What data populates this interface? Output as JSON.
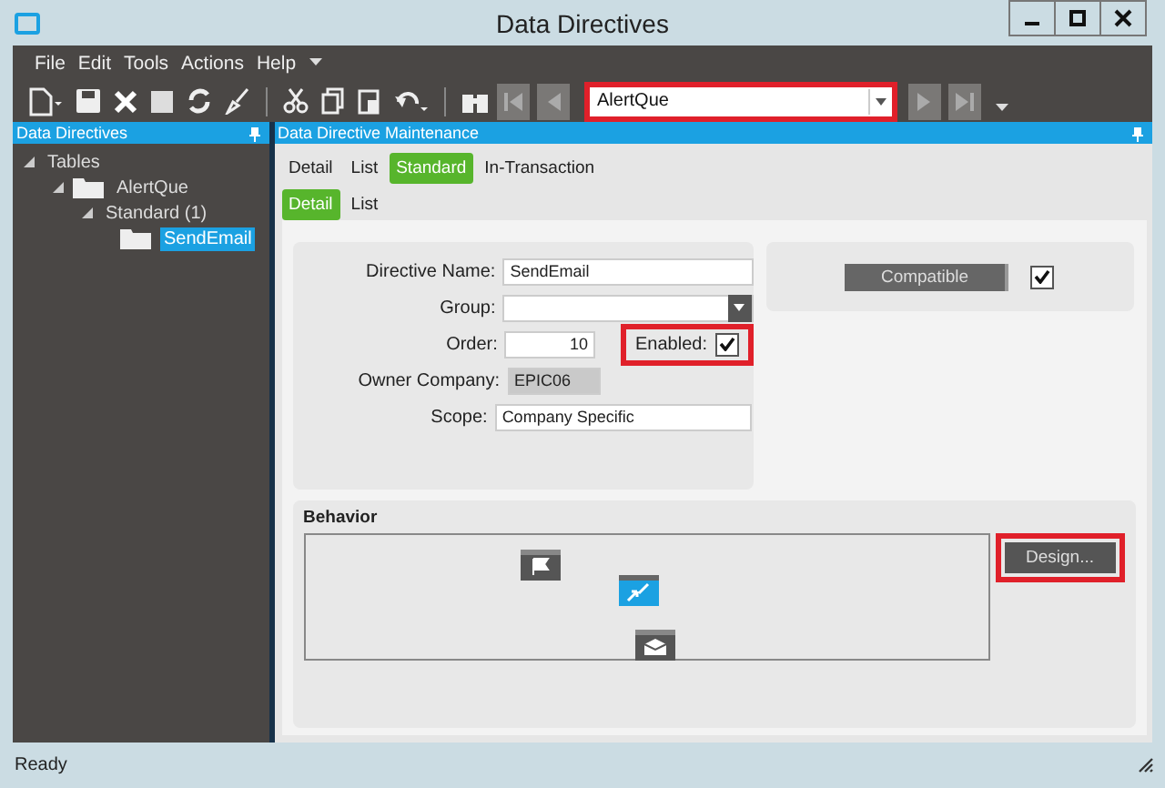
{
  "window": {
    "title": "Data Directives"
  },
  "menu": [
    "File",
    "Edit",
    "Tools",
    "Actions",
    "Help"
  ],
  "toolbar": {
    "record": {
      "value": "AlertQue",
      "highlighted": true
    }
  },
  "tree_panel": {
    "title": "Data Directives",
    "tree": [
      {
        "label": "Tables",
        "expanded": true,
        "folder": false,
        "selected": false,
        "children": [
          {
            "label": "AlertQue",
            "expanded": true,
            "folder": true,
            "selected": false,
            "children": [
              {
                "label": "Standard (1)",
                "expanded": true,
                "folder": false,
                "selected": false,
                "children": [
                  {
                    "label": "SendEmail",
                    "folder": true,
                    "selected": true
                  }
                ]
              }
            ]
          }
        ]
      }
    ]
  },
  "main_panel": {
    "title": "Data Directive Maintenance",
    "tabs": [
      {
        "label": "Detail",
        "selected": false
      },
      {
        "label": "List",
        "selected": false
      },
      {
        "label": "Standard",
        "selected": true
      },
      {
        "label": "In-Transaction",
        "selected": false
      }
    ],
    "subtabs": [
      {
        "label": "Detail",
        "selected": true
      },
      {
        "label": "List",
        "selected": false
      }
    ],
    "form": {
      "directive_name": {
        "label": "Directive Name:",
        "value": "SendEmail"
      },
      "group": {
        "label": "Group:"
      },
      "order": {
        "label": "Order:",
        "value": "10"
      },
      "enabled": {
        "label": "Enabled:",
        "checked": true,
        "highlighted": true
      },
      "owner_company": {
        "label": "Owner Company:",
        "value": "EPIC06"
      },
      "scope": {
        "label": "Scope:",
        "value": "Company Specific"
      }
    },
    "compatible": {
      "label": "Compatible",
      "checked": true
    },
    "behavior": {
      "title": "Behavior",
      "nodes": [
        {
          "kind": "start"
        },
        {
          "kind": "condition"
        },
        {
          "kind": "email"
        }
      ],
      "design_button": {
        "label": "Design...",
        "highlighted": true
      }
    }
  },
  "status_bar": {
    "text": "Ready"
  }
}
